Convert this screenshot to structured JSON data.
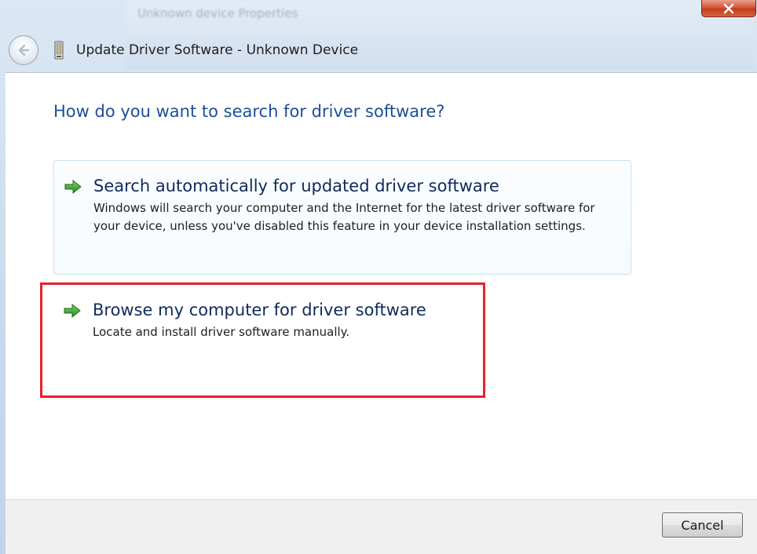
{
  "window": {
    "title": "Update Driver Software - Unknown Device",
    "background_title": "Unknown device Properties",
    "close_icon": "close-icon",
    "back_icon": "back-arrow-icon",
    "device_icon": "device-icon"
  },
  "main": {
    "question": "How do you want to search for driver software?",
    "options": [
      {
        "title": "Search automatically for updated driver software",
        "description": "Windows will search your computer and the Internet for the latest driver software for your device, unless you've disabled this feature in your device installation settings.",
        "icon": "green-arrow-icon"
      },
      {
        "title": "Browse my computer for driver software",
        "description": "Locate and install driver software manually.",
        "icon": "green-arrow-icon",
        "highlighted": true
      }
    ]
  },
  "footer": {
    "cancel_label": "Cancel"
  },
  "colors": {
    "heading_blue": "#1e4d9a",
    "option_title": "#102a5c",
    "arrow_green": "#2f9e2f",
    "highlight_red": "#e8202b",
    "close_red": "#c43b1f"
  }
}
